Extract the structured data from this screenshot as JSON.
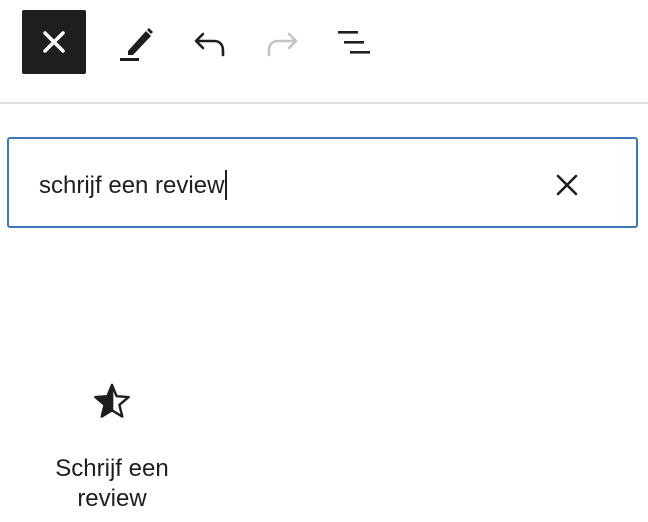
{
  "toolbar": {
    "icons": [
      "close-icon",
      "pencil-icon",
      "undo-icon",
      "redo-icon",
      "list-view-icon"
    ],
    "close_bg": "#1e1e1e",
    "redo_color": "#c3c4c7"
  },
  "search": {
    "value": "schrijf een review",
    "border_color": "#3f78b6"
  },
  "results": {
    "items": [
      {
        "label": "Schrijf een review",
        "icon": "half-star-icon"
      }
    ]
  }
}
